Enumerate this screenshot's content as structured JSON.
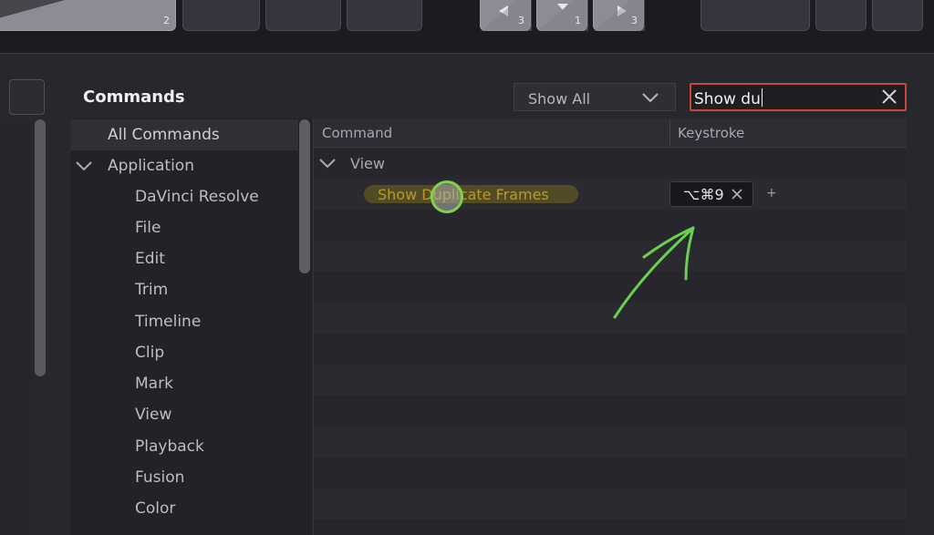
{
  "top_keys": [
    {
      "number": "2",
      "style": "light"
    },
    {
      "number": "",
      "style": "dark"
    },
    {
      "number": "",
      "style": "dark"
    },
    {
      "number": "",
      "style": "dark"
    },
    {
      "number": "3",
      "style": "light"
    },
    {
      "number": "1",
      "style": "light"
    },
    {
      "number": "3",
      "style": "light"
    },
    {
      "number": "",
      "style": "dark"
    },
    {
      "number": "",
      "style": "dark"
    },
    {
      "number": "",
      "style": "dark"
    }
  ],
  "commands": {
    "title": "Commands",
    "filter": {
      "selected": "Show All"
    },
    "search": {
      "value": "Show du"
    },
    "categories": [
      {
        "label": "All Commands",
        "selected": true
      },
      {
        "label": "Application",
        "expanded": true
      },
      {
        "label": "DaVinci Resolve"
      },
      {
        "label": "File"
      },
      {
        "label": "Edit"
      },
      {
        "label": "Trim"
      },
      {
        "label": "Timeline"
      },
      {
        "label": "Clip"
      },
      {
        "label": "Mark"
      },
      {
        "label": "View"
      },
      {
        "label": "Playback"
      },
      {
        "label": "Fusion"
      },
      {
        "label": "Color"
      }
    ],
    "table": {
      "columns": [
        "Command",
        "Keystroke"
      ],
      "group": "View",
      "rows": [
        {
          "command": "Show Duplicate Frames",
          "keystroke": "⌥⌘9"
        }
      ]
    }
  },
  "colors": {
    "accent_search_border": "#c8473b",
    "command_match_text": "#b59a2c",
    "annotation_arrow": "#6ad14f",
    "cursor_ring": "#7fd24a"
  },
  "icons": [
    "chevron-down-icon",
    "close-icon",
    "plus-icon",
    "annotation-arrow-icon"
  ]
}
